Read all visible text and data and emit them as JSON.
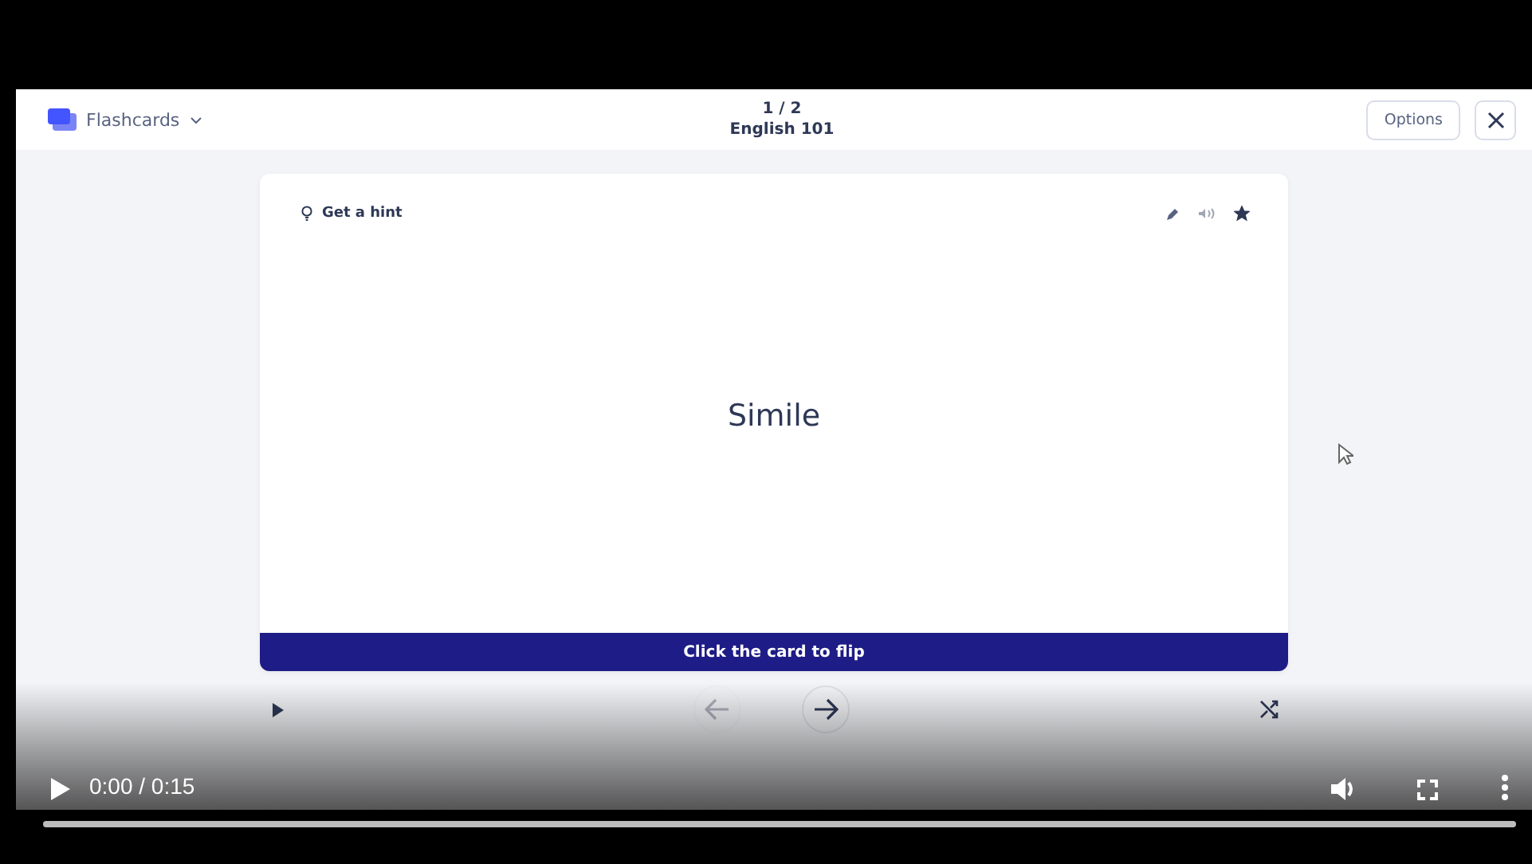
{
  "app": {
    "mode": "Flashcards",
    "progress": "1 / 2",
    "deck": "English 101",
    "options": "Options"
  },
  "card": {
    "hint": "Get a hint",
    "term": "Simile",
    "flip_label": "Click the card to flip",
    "starred": true
  },
  "nav": {
    "prev_disabled": true
  },
  "player": {
    "time": "0:00 / 0:15",
    "playing": false,
    "level": 0
  }
}
